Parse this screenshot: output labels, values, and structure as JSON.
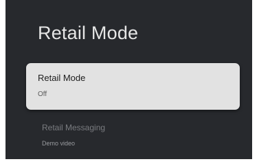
{
  "page": {
    "title": "Retail Mode"
  },
  "settings": [
    {
      "label": "Retail Mode",
      "value": "Off",
      "focused": true
    },
    {
      "label": "Retail Messaging",
      "value": "Demo video",
      "focused": false
    }
  ],
  "colors": {
    "panel_background": "#27292d",
    "focused_card": "#e2e2e2",
    "title_text": "#e6e6e6",
    "dim_text": "#7a7c80"
  }
}
